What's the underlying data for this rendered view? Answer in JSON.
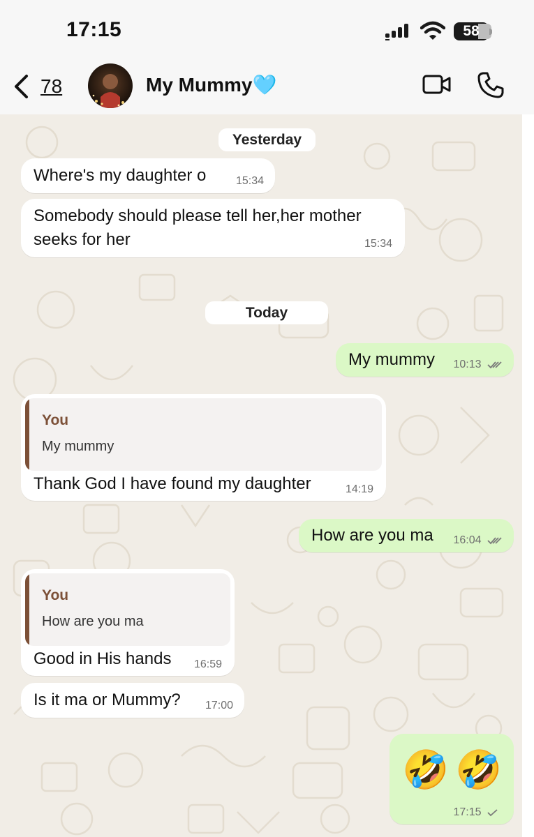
{
  "status_bar": {
    "time": "17:15",
    "battery": "58",
    "battery_level": 0.58,
    "icons": [
      "cellular-signal-icon",
      "wifi-icon",
      "battery-icon"
    ]
  },
  "header": {
    "back_count": "78",
    "contact_name": "My Mummy🩵",
    "icons": [
      "chevron-left-icon",
      "video-camera-icon",
      "phone-icon"
    ]
  },
  "day_separators": {
    "yesterday": "Yesterday",
    "today": "Today"
  },
  "messages": [
    {
      "direction": "in",
      "text": "Where's my daughter o",
      "time": "15:34"
    },
    {
      "direction": "in",
      "text": "Somebody should please tell her,her mother seeks for her",
      "time": "15:34"
    },
    {
      "direction": "out",
      "text": "My mummy",
      "time": "10:13",
      "status": "read"
    },
    {
      "direction": "in",
      "quote_author": "You",
      "quote_text": "My mummy",
      "text": "Thank God I have found my daughter",
      "time": "14:19"
    },
    {
      "direction": "out",
      "text": "How are you ma",
      "time": "16:04",
      "status": "read"
    },
    {
      "direction": "in",
      "quote_author": "You",
      "quote_text": "How are you ma",
      "text": "Good in His hands",
      "time": "16:59"
    },
    {
      "direction": "in",
      "text": "Is it ma or Mummy?",
      "time": "17:00"
    },
    {
      "direction": "out",
      "emoji": [
        "🤣",
        "🤣"
      ],
      "time": "17:15",
      "status": "sent"
    }
  ],
  "colors": {
    "outgoing_bubble": "#dbf8c6",
    "incoming_bubble": "#ffffff",
    "quote_accent": "#7c5037",
    "chat_background": "#f1ede6"
  }
}
